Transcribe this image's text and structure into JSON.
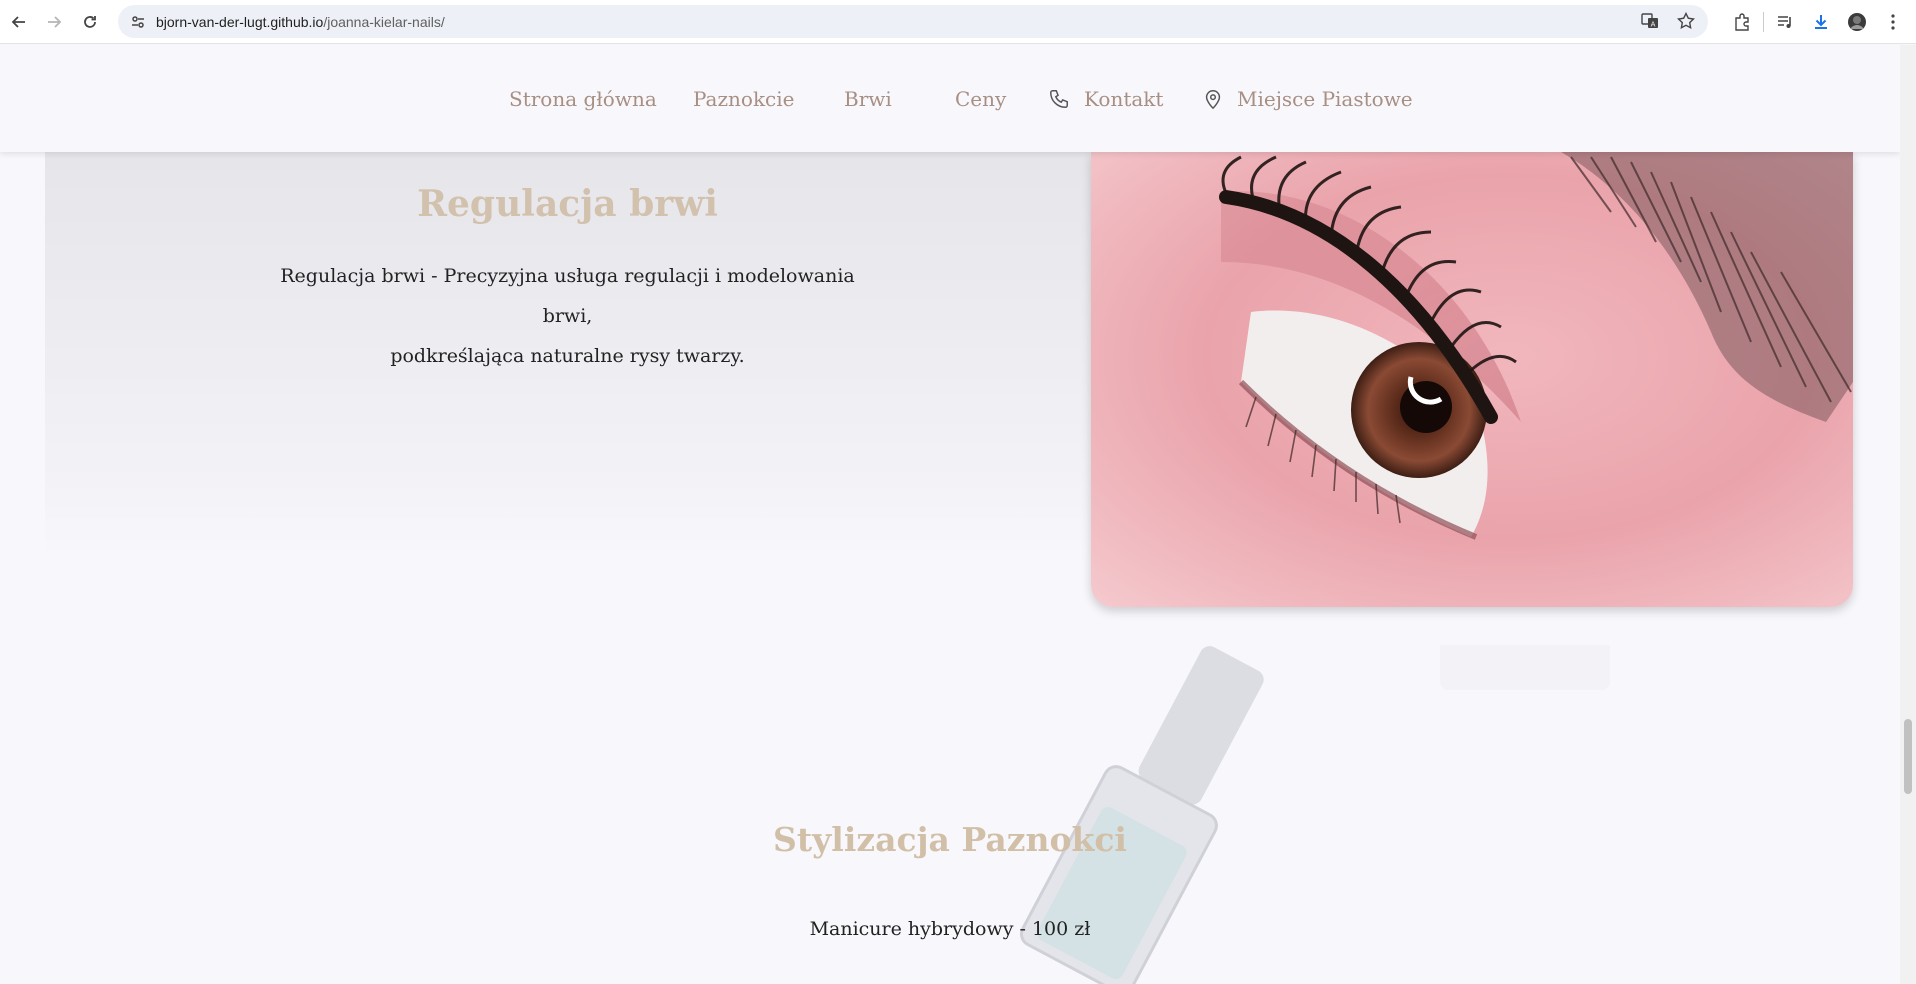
{
  "browser": {
    "url_host": "bjorn-van-der-lugt.github.io",
    "url_path": "/joanna-kielar-nails/"
  },
  "nav": {
    "home": "Strona główna",
    "nails": "Paznokcie",
    "brows": "Brwi",
    "prices": "Ceny",
    "contact": "Kontakt",
    "location": "Miejsce Piastowe"
  },
  "brows_section": {
    "title": "Regulacja brwi",
    "description_line1": "Regulacja brwi - Precyzyjna usługa regulacji i modelowania brwi,",
    "description_line2": "podkreślająca naturalne rysy twarzy."
  },
  "nails_section": {
    "title": "Stylizacja Paznokci",
    "item1": "Manicure hybrydowy - 100 zł"
  },
  "colors": {
    "nav_text": "#a88f84",
    "heading": "#d1c1ad",
    "background": "#f8f8fc"
  }
}
